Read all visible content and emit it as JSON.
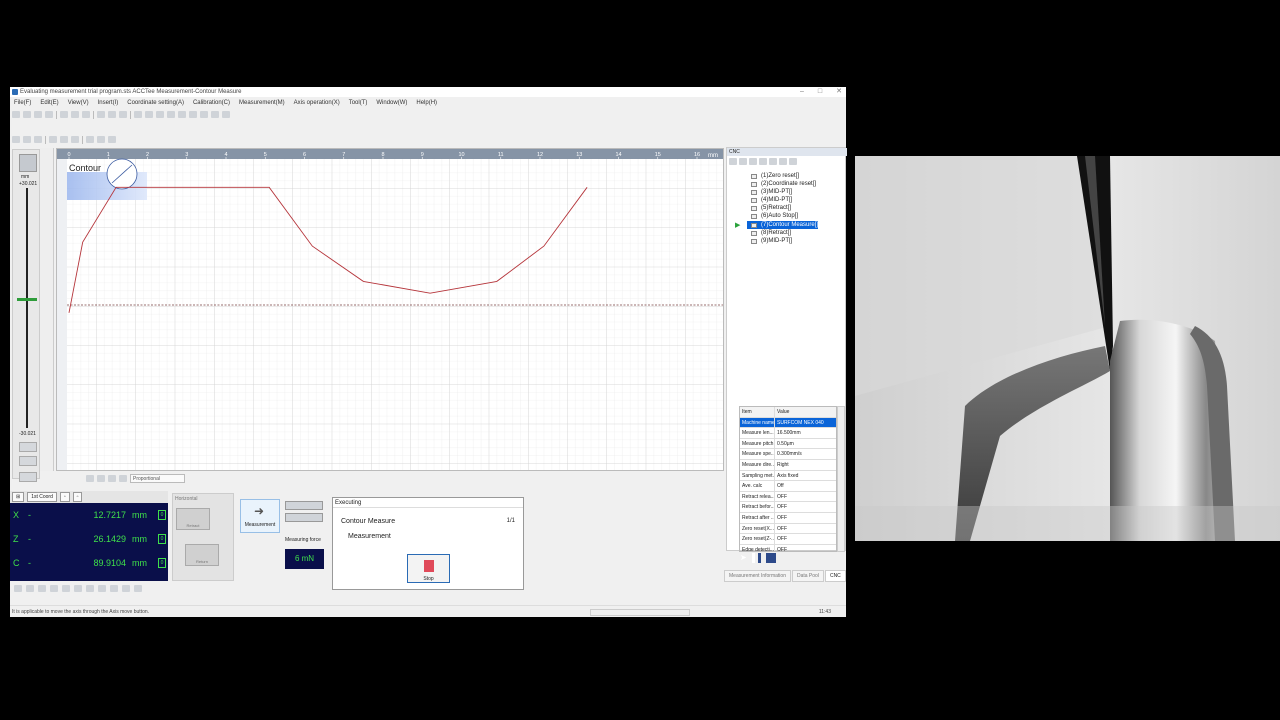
{
  "window": {
    "title": "Evaluating measurement trial program.sts ACCTee Measurement-Contour Measure",
    "controls": [
      "–",
      "□",
      "✕"
    ]
  },
  "menu": [
    "File(F)",
    "Edit(E)",
    "View(V)",
    "Insert(I)",
    "Coordinate setting(A)",
    "Calibration(C)",
    "Measurement(M)",
    "Axis operation(X)",
    "Tool(T)",
    "Window(W)",
    "Help(H)"
  ],
  "gauge": {
    "unit": "mm",
    "max": "+30.021",
    "min": "-30.021"
  },
  "plot": {
    "title": "Contour",
    "unit": "mm",
    "x_ticks": [
      "0",
      "1",
      "2",
      "3",
      "4",
      "5",
      "6",
      "7",
      "8",
      "9",
      "10",
      "11",
      "12",
      "13",
      "14",
      "15",
      "16"
    ],
    "profile_points_mm": [
      [
        0,
        -0.2
      ],
      [
        0.35,
        1.6
      ],
      [
        1.2,
        3.0
      ],
      [
        5.1,
        3.0
      ],
      [
        6.2,
        1.5
      ],
      [
        7.5,
        0.6
      ],
      [
        9.2,
        0.3
      ],
      [
        10.9,
        0.6
      ],
      [
        12.1,
        1.5
      ],
      [
        13.2,
        3.0
      ]
    ],
    "baseline_y_mm": 0
  },
  "plot_bar": {
    "scale_mode": "Proportional"
  },
  "cnc": {
    "header": "CNC",
    "items": [
      {
        "label": "(1)Zero reset[]",
        "selected": false
      },
      {
        "label": "(2)Coordinate reset[]",
        "selected": false
      },
      {
        "label": "(3)MID-PT[]",
        "selected": false
      },
      {
        "label": "(4)MID-PT[]",
        "selected": false
      },
      {
        "label": "(5)Retract[]",
        "selected": false
      },
      {
        "label": "(6)Auto Stop[]",
        "selected": false
      },
      {
        "label": "(7)Contour Measure[]",
        "selected": true
      },
      {
        "label": "(8)Retract[]",
        "selected": false
      },
      {
        "label": "(9)MID-PT[]",
        "selected": false
      }
    ],
    "current_marker": "▶"
  },
  "properties": {
    "headers": [
      "Item",
      "Value"
    ],
    "rows": [
      {
        "k": "Machine name",
        "v": "SURFCOM NEX 040",
        "selected": true
      },
      {
        "k": "Measure len...",
        "v": "16.500mm",
        "selected": false
      },
      {
        "k": "Measure pitch",
        "v": "0.50μm",
        "selected": false
      },
      {
        "k": "Measure spe...",
        "v": "0.300mm/s",
        "selected": false
      },
      {
        "k": "Measure dire...",
        "v": "Right",
        "selected": false
      },
      {
        "k": "Sampling met...",
        "v": "Axis fixed",
        "selected": false
      },
      {
        "k": "Ave. calc",
        "v": "Off",
        "selected": false
      },
      {
        "k": "Retract relea...",
        "v": "OFF",
        "selected": false
      },
      {
        "k": "Retract befor...",
        "v": "OFF",
        "selected": false
      },
      {
        "k": "Retract after ...",
        "v": "OFF",
        "selected": false
      },
      {
        "k": "Zero reset(X...",
        "v": "OFF",
        "selected": false
      },
      {
        "k": "Zero reset(Z-...",
        "v": "OFF",
        "selected": false
      },
      {
        "k": "Edge detecti...",
        "v": "OFF",
        "selected": false
      }
    ]
  },
  "bottom_tabs": [
    {
      "label": "Measurement Information",
      "active": false
    },
    {
      "label": "Data Pool",
      "active": false
    },
    {
      "label": "CNC",
      "active": true
    }
  ],
  "coords": {
    "tab_label": "1st Coord",
    "unit": "mm",
    "zero_label": "0",
    "rows": [
      {
        "axis": "X",
        "sign": "-",
        "value": "12.7217"
      },
      {
        "axis": "Z",
        "sign": "-",
        "value": "26.1429"
      },
      {
        "axis": "C",
        "sign": "-",
        "value": "89.9104"
      }
    ]
  },
  "axis_panel": {
    "mode": "Horizontal",
    "retract_label": "Retract",
    "return_label": "Return"
  },
  "measurement": {
    "button_label": "Measurement",
    "force_label": "Measuring force",
    "force_value": "6 mN"
  },
  "exec_dialog": {
    "header": "Executing",
    "title": "Contour Measure",
    "count": "1/1",
    "step": "Measurement",
    "stop_label": "Stop"
  },
  "status": {
    "message": "It is applicable to move the axis through the Axis move button.",
    "time": "11:43"
  },
  "colors": {
    "profile": "#b5343a",
    "selection": "#0a64d8",
    "display_bg": "#0a0f4a",
    "display_fg": "#3fe04a"
  }
}
